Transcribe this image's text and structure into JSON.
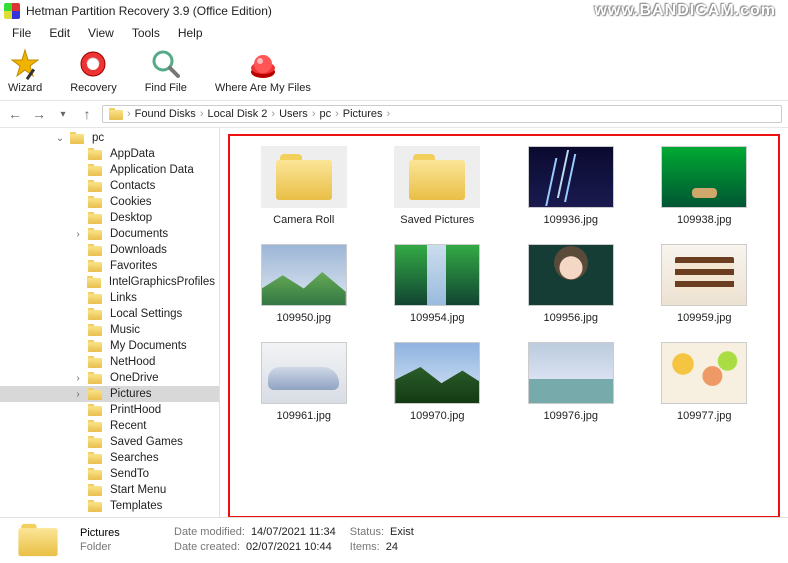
{
  "window": {
    "title": "Hetman Partition Recovery 3.9 (Office Edition)",
    "watermark": "www.BANDICAM.com"
  },
  "menu": {
    "items": [
      "File",
      "Edit",
      "View",
      "Tools",
      "Help"
    ]
  },
  "toolbar": {
    "wizard": "Wizard",
    "recovery": "Recovery",
    "findfile": "Find File",
    "where": "Where Are My Files"
  },
  "breadcrumb": {
    "segments": [
      "Found Disks",
      "Local Disk 2",
      "Users",
      "pc",
      "Pictures"
    ]
  },
  "tree": {
    "root": "pc",
    "items": [
      "AppData",
      "Application Data",
      "Contacts",
      "Cookies",
      "Desktop",
      "Documents",
      "Downloads",
      "Favorites",
      "IntelGraphicsProfiles",
      "Links",
      "Local Settings",
      "Music",
      "My Documents",
      "NetHood",
      "OneDrive",
      "Pictures",
      "PrintHood",
      "Recent",
      "Saved Games",
      "Searches",
      "SendTo",
      "Start Menu",
      "Templates"
    ],
    "expandable": [
      "Documents",
      "OneDrive",
      "Pictures"
    ],
    "selected": "Pictures"
  },
  "files": {
    "items": [
      {
        "name": "Camera Roll",
        "kind": "folder"
      },
      {
        "name": "Saved Pictures",
        "kind": "folder"
      },
      {
        "name": "109936.jpg",
        "kind": "image",
        "art": "t-lightning"
      },
      {
        "name": "109938.jpg",
        "kind": "image",
        "art": "t-forest"
      },
      {
        "name": "109950.jpg",
        "kind": "image",
        "art": "t-mountain"
      },
      {
        "name": "109954.jpg",
        "kind": "image",
        "art": "t-waterfall"
      },
      {
        "name": "109956.jpg",
        "kind": "image",
        "art": "t-portrait"
      },
      {
        "name": "109959.jpg",
        "kind": "image",
        "art": "t-cake"
      },
      {
        "name": "109961.jpg",
        "kind": "image",
        "art": "t-car"
      },
      {
        "name": "109970.jpg",
        "kind": "image",
        "art": "t-valley"
      },
      {
        "name": "109976.jpg",
        "kind": "image",
        "art": "t-harbor"
      },
      {
        "name": "109977.jpg",
        "kind": "image",
        "art": "t-food"
      }
    ]
  },
  "status": {
    "name": "Pictures",
    "type": "Folder",
    "date_modified_label": "Date modified:",
    "date_modified": "14/07/2021 11:34",
    "date_created_label": "Date created:",
    "date_created": "02/07/2021 10:44",
    "status_label": "Status:",
    "status_value": "Exist",
    "items_label": "Items:",
    "items_value": "24"
  }
}
